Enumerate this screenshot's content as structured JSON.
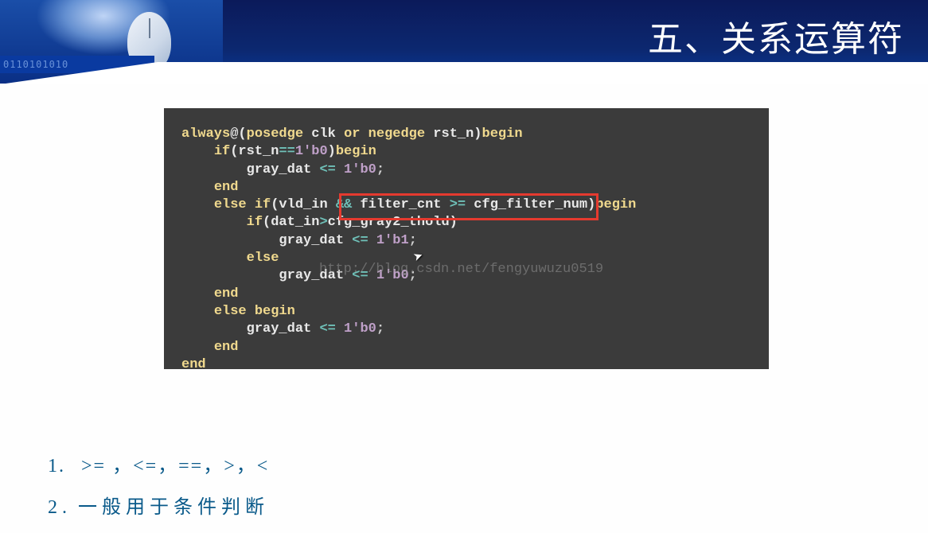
{
  "header": {
    "title": "五、关系运算符",
    "binary": "0110101010"
  },
  "code": {
    "l1a": "always",
    "l1b": "@(",
    "l1c": "posedge",
    "l1d": " clk ",
    "l1e": "or",
    "l1f": " ",
    "l1g": "negedge",
    "l1h": " rst_n)",
    "l1i": "begin",
    "l2a": "    ",
    "l2b": "if",
    "l2c": "(rst_n",
    "l2d": "==",
    "l2e": "1'b0",
    "l2f": ")",
    "l2g": "begin",
    "l3a": "        gray_dat ",
    "l3b": "<=",
    "l3c": " ",
    "l3d": "1'b0",
    "l3e": ";",
    "l4a": "    ",
    "l4b": "end",
    "l5a": "    ",
    "l5b": "else if",
    "l5c": "(vld_in ",
    "l5d": "&&",
    "l5e": " filter_cnt ",
    "l5f": ">=",
    "l5g": " cfg_filter_num)",
    "l5h": "begin",
    "l6a": "        ",
    "l6b": "if",
    "l6c": "(dat_in",
    "l6d": ">",
    "l6e": "cfg_gray2_thold)",
    "l7a": "            gray_dat ",
    "l7b": "<=",
    "l7c": " ",
    "l7d": "1'b1",
    "l7e": ";",
    "l8a": "        ",
    "l8b": "else",
    "l9a": "            gray_dat ",
    "l9b": "<=",
    "l9c": " ",
    "l9d": "1'b0",
    "l9e": ";",
    "l10a": "    ",
    "l10b": "end",
    "l11a": "    ",
    "l11b": "else begin",
    "l12a": "        gray_dat ",
    "l12b": "<=",
    "l12c": " ",
    "l12d": "1'b0",
    "l12e": ";",
    "l13a": "    ",
    "l13b": "end",
    "l14a": "",
    "l14b": "end"
  },
  "watermark": "http://blog.csdn.net/fengyuwuzu0519",
  "notes": {
    "n1": "1.",
    "t1": ">= ，<=，==，>，<",
    "n2": "2.",
    "t2": "一般用于条件判断"
  }
}
